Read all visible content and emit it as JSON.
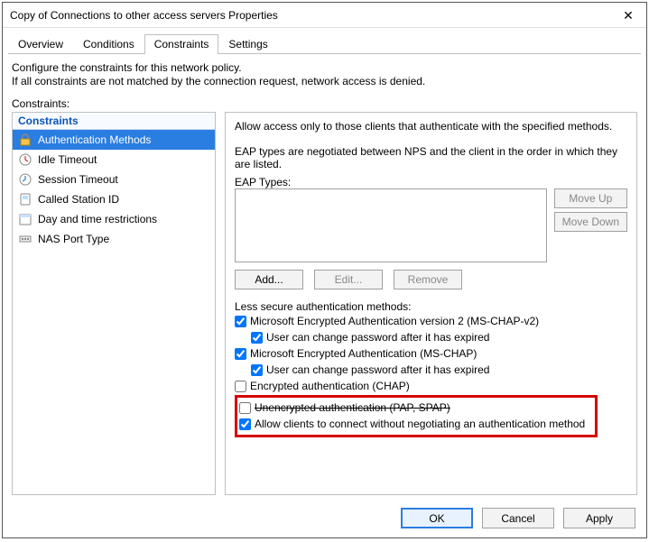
{
  "window": {
    "title": "Copy of Connections to other access servers Properties"
  },
  "tabs": {
    "t0": "Overview",
    "t1": "Conditions",
    "t2": "Constraints",
    "t3": "Settings"
  },
  "desc1": "Configure the constraints for this network policy.",
  "desc2": "If all constraints are not matched by the connection request, network access is denied.",
  "left": {
    "label": "Constraints:",
    "header": "Constraints",
    "items": [
      "Authentication Methods",
      "Idle Timeout",
      "Session Timeout",
      "Called Station ID",
      "Day and time restrictions",
      "NAS Port Type"
    ]
  },
  "right": {
    "intro": "Allow access only to those clients that authenticate with the specified methods.",
    "eap_desc": "EAP types are negotiated between NPS and the client in the order in which they are listed.",
    "eap_label": "EAP Types:",
    "buttons": {
      "moveup": "Move Up",
      "movedown": "Move Down",
      "add": "Add...",
      "edit": "Edit...",
      "remove": "Remove"
    },
    "less_label": "Less secure authentication methods:",
    "checks": {
      "c0": "Microsoft Encrypted Authentication version 2 (MS-CHAP-v2)",
      "c1": "User can change password after it has expired",
      "c2": "Microsoft Encrypted Authentication (MS-CHAP)",
      "c3": "User can change password after it has expired",
      "c4": "Encrypted authentication (CHAP)",
      "c5": "Unencrypted authentication (PAP, SPAP)",
      "c6": "Allow clients to connect without negotiating an authentication method"
    }
  },
  "footer": {
    "ok": "OK",
    "cancel": "Cancel",
    "apply": "Apply"
  }
}
